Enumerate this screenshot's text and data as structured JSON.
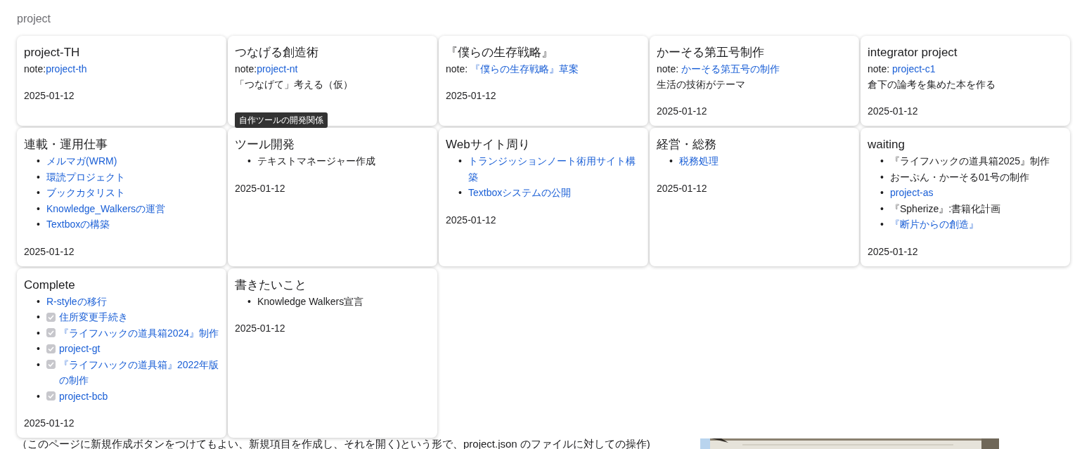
{
  "page_title": "project",
  "cards": [
    {
      "title": "project-TH",
      "note": {
        "prefix": "note:",
        "link": "project-th"
      },
      "date": "2025-01-12"
    },
    {
      "title": "つなげる創造術",
      "note": {
        "prefix": "note:",
        "link": "project-nt"
      },
      "description": "「つなげて」考える（仮）",
      "tooltip": "自作ツールの開発関係"
    },
    {
      "title": "『僕らの生存戦略』",
      "note": {
        "prefix": "note: ",
        "link": "『僕らの生存戦略』草案"
      },
      "date": "2025-01-12"
    },
    {
      "title": "かーそる第五号制作",
      "note": {
        "prefix": "note: ",
        "link": "かーそる第五号の制作"
      },
      "description": "生活の技術がテーマ",
      "date": "2025-01-12"
    },
    {
      "title": "integrator project",
      "note": {
        "prefix": "note: ",
        "link": "project-c1"
      },
      "description": "倉下の論考を集めた本を作る",
      "date": "2025-01-12"
    },
    {
      "title": "連載・運用仕事",
      "bullet": "•",
      "items": [
        {
          "kind": "link",
          "text": "メルマガ(WRM)"
        },
        {
          "kind": "link",
          "text": "環読プロジェクト"
        },
        {
          "kind": "link",
          "text": "ブックカタリスト"
        },
        {
          "kind": "link",
          "text": "Knowledge_Walkersの運営"
        },
        {
          "kind": "link",
          "text": "Textboxの構築"
        }
      ],
      "date": "2025-01-12"
    },
    {
      "title": "ツール開発",
      "bullet": "•",
      "items": [
        {
          "kind": "text",
          "text": "テキストマネージャー作成"
        }
      ],
      "date": "2025-01-12"
    },
    {
      "title": "Webサイト周り",
      "bullet": "•",
      "items": [
        {
          "kind": "link",
          "text": "トランジッションノート術用サイト構築"
        },
        {
          "kind": "link",
          "text": "Textboxシステムの公開"
        }
      ],
      "date": "2025-01-12"
    },
    {
      "title": "経営・総務",
      "bullet": "•",
      "items": [
        {
          "kind": "link",
          "text": "税務処理"
        }
      ],
      "date": "2025-01-12"
    },
    {
      "title": "waiting",
      "bullet": "•",
      "items": [
        {
          "kind": "text",
          "text": "『ライフハックの道具箱2025』制作"
        },
        {
          "kind": "text",
          "text": "おーぷん・かーそる01号の制作"
        },
        {
          "kind": "link",
          "text": "project-as"
        },
        {
          "kind": "text",
          "text": "『Spherize』:書籍化計画"
        },
        {
          "kind": "link",
          "text": "『断片からの創造』"
        }
      ],
      "date": "2025-01-12"
    },
    {
      "title": "Complete",
      "bullet": "•",
      "items": [
        {
          "kind": "link",
          "text": "R-styleの移行"
        },
        {
          "kind": "task",
          "text": "住所変更手続き",
          "checked": true
        },
        {
          "kind": "task",
          "text": "『ライフハックの道具箱2024』制作",
          "checked": true
        },
        {
          "kind": "task",
          "text": "project-gt",
          "checked": true
        },
        {
          "kind": "task",
          "text": "『ライフハックの道具箱』2022年版の制作",
          "checked": true
        },
        {
          "kind": "task",
          "text": "project-bcb",
          "checked": true
        }
      ],
      "date": "2025-01-12"
    },
    {
      "title": "書きたいこと",
      "bullet": "•",
      "items": [
        {
          "kind": "text",
          "text": "Knowledge Walkers宣言"
        }
      ],
      "date": "2025-01-12"
    }
  ],
  "footer": {
    "text": "（このページに新規作成ボタンをつけてもよい、新規項目を作成し、それを開く)という形で、project.json のファイルに対しての操作)"
  }
}
